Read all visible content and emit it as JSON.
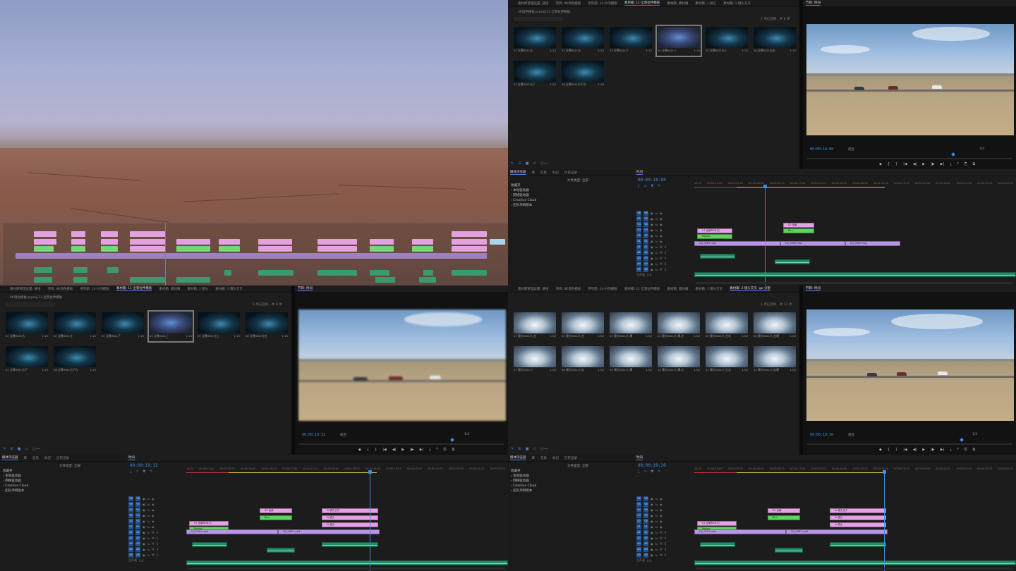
{
  "bin_tabs": [
    "素材库管理设置: 链接",
    "项目: 4K调色模板",
    "序列题: 14·片的模板",
    "素材箱: 11·全景拉伸模板",
    "素材箱: 素材箱",
    "素材箱: 1·镜头",
    "素材箱: 1·镜头交叉"
  ],
  "bin_tabs_br": [
    "素材库管理设置: 链接",
    "项目: 4K调色模板",
    "序列题: 14·片的模板",
    "素材箱: 11·全景拉伸模板",
    "素材箱: 素材箱",
    "素材箱: 1·镜头交叉",
    "素材箱: 2·镜头交叉 -go 分割",
    "素材箱: 1·镜头"
  ],
  "bin_path": "4K调色模板.prproj\\11·全景拉伸模板",
  "bin_path_br": "4K调色模板.prproj\\2·镜头交叉",
  "bin_count": "1 项已选择，共 8 项",
  "bin_count_br": "1 项已选择，共 12 项",
  "dark_items": [
    {
      "name": "01 全景RGB-右",
      "dur": "1;15"
    },
    {
      "name": "02 全景RGB-左",
      "dur": "1;15"
    },
    {
      "name": "03 全景RGB-下",
      "dur": "1;15"
    },
    {
      "name": "04 全景RGB-上",
      "dur": "1;15"
    },
    {
      "name": "05 全景RGB-左上",
      "dur": "1;15"
    },
    {
      "name": "06 全景RGB-左右",
      "dur": "1;15"
    },
    {
      "name": "07 全景RGB-右下",
      "dur": "1;15"
    },
    {
      "name": "08 全景RGB-右下右",
      "dur": "1;15"
    }
  ],
  "tunnel_items": [
    {
      "name": "01 镜头RGB-大-右",
      "dur": "1;00"
    },
    {
      "name": "02 镜头RGB-大-左",
      "dur": "1;00"
    },
    {
      "name": "03 镜头RGB-大-横",
      "dur": "1;00"
    },
    {
      "name": "04 镜头RGB-大-横-左",
      "dur": "1;00"
    },
    {
      "name": "05 镜头RGB-大-左右",
      "dur": "1;00"
    },
    {
      "name": "06 镜头RGB-大-右横",
      "dur": "1;00"
    },
    {
      "name": "07 镜头RGB-小",
      "dur": "1;00"
    },
    {
      "name": "08 镜头RGB-小-右",
      "dur": "1;00"
    },
    {
      "name": "09 镜头RGB-小-横",
      "dur": "1;00"
    },
    {
      "name": "10 镜头RGB-小-横-左",
      "dur": "1;00"
    },
    {
      "name": "11 镜头RGB-小-左右",
      "dur": "1;00"
    },
    {
      "name": "12 镜头RGB-小-右横",
      "dur": "1;00"
    }
  ],
  "monitor": {
    "title": "节目: 时间",
    "tc_tr": "00:00:18:08",
    "tc_bl": "00:00:19:12",
    "tc_br": "00:00:19:20",
    "fit": "适合",
    "res": "1/4",
    "transport": [
      "◆",
      "{",
      "}",
      "|◀",
      "◀|",
      "▶",
      "|▶",
      "▶|",
      "⤓",
      "⤒",
      "⎘",
      "⧉"
    ]
  },
  "project": {
    "tabs": [
      "媒体浏览器",
      "库",
      "信息",
      "标记",
      "历史记录",
      "≡"
    ],
    "tree": [
      "收藏夹",
      "› 本地驱动器",
      "› 网络驱动器",
      "› Creative Cloud",
      "  › 团队项目版本"
    ],
    "filter": "文件类型: 全部"
  },
  "timeline": {
    "title": "时间",
    "tc_tr": "00:00:18:08",
    "tc_bl": "00:00:19:12",
    "tc_br": "00:00:19:20",
    "ruler": [
      "14:23",
      "00:00:15:00",
      "00:00:15:23",
      "00:00:16:00",
      "00:00:16:23",
      "00:00:17:00",
      "00:00:17:23",
      "00:00:18:00",
      "00:00:18:23",
      "00:00:19:00",
      "00:00:19:23",
      "00:00:20:00",
      "00:00:20:23",
      "00:00:21:00",
      "00:00:21:23",
      "00:00:22:00"
    ],
    "tracks_v": [
      "V6",
      "V5",
      "V4",
      "V3",
      "V2",
      "V1"
    ],
    "tracks_a": [
      "A1",
      "A2",
      "A3",
      "A4",
      "A5"
    ],
    "master": "主声道",
    "master_val": "0.0",
    "clip_labels": {
      "pink1": "01 全景RGB-右",
      "pink2": "02 全景",
      "pink3": "fx 镜头",
      "pink4": "fx 镜头交叉",
      "purple1": "DJI_0081.mp4",
      "purple2": "DJI_0082.mp4",
      "purple3": "DJI_0083.mp4",
      "green1": "Mosaic",
      "green2": "Blur"
    }
  },
  "colors": {
    "accent": "#3d8ee8",
    "clip_pink": "#e6a2e6",
    "clip_green": "#5ed45e",
    "clip_purple": "#b896e6",
    "clip_audio": "#1e8f68"
  }
}
